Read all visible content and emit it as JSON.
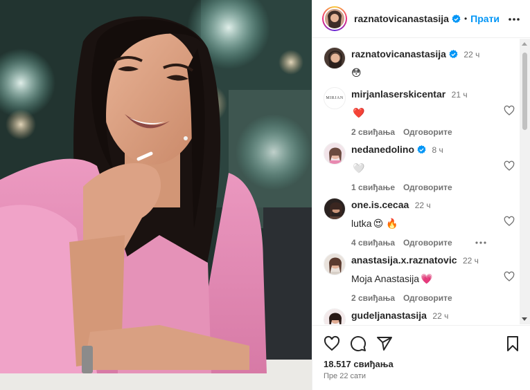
{
  "post": {
    "author": "raznatovicanastasija",
    "follow_label": "Прати",
    "separator": "•",
    "likes": "18.517 свиђања",
    "posted": "Пре 22 сати"
  },
  "caption": {
    "user": "raznatovicanastasija",
    "time": "22 ч",
    "emoji": "😳"
  },
  "comments": [
    {
      "user": "mirjanlaserskicentar",
      "time": "21 ч",
      "text": "",
      "emoji": "❤️",
      "likes": "2 свиђања",
      "reply": "Одговорите",
      "avatar_text": "MIRJAN"
    },
    {
      "user": "nedanedolino",
      "time": "8 ч",
      "text": "",
      "emoji": "🤍",
      "likes": "1 свиђање",
      "reply": "Одговорите"
    },
    {
      "user": "one.is.cecaa",
      "time": "22 ч",
      "text": "lutka",
      "emoji": "😍 🔥",
      "likes": "4 свиђања",
      "reply": "Одговорите"
    },
    {
      "user": "anastasija.x.raznatovic",
      "time": "22 ч",
      "text": "Moja Anastasija",
      "emoji": "💗",
      "likes": "2 свиђања",
      "reply": "Одговорите"
    },
    {
      "user": "gudeljanastasija",
      "time": "22 ч",
      "text": "",
      "emoji": "😍😍😍",
      "likes": "",
      "reply": ""
    }
  ],
  "colors": {
    "accent": "#0095f6",
    "verified": "#0095f6",
    "text": "#262626",
    "muted": "#737373",
    "jacket": "#e58cb6"
  },
  "icons": [
    "verified-badge-icon",
    "more-options-icon",
    "heart-icon",
    "comment-icon",
    "share-icon",
    "save-icon"
  ]
}
